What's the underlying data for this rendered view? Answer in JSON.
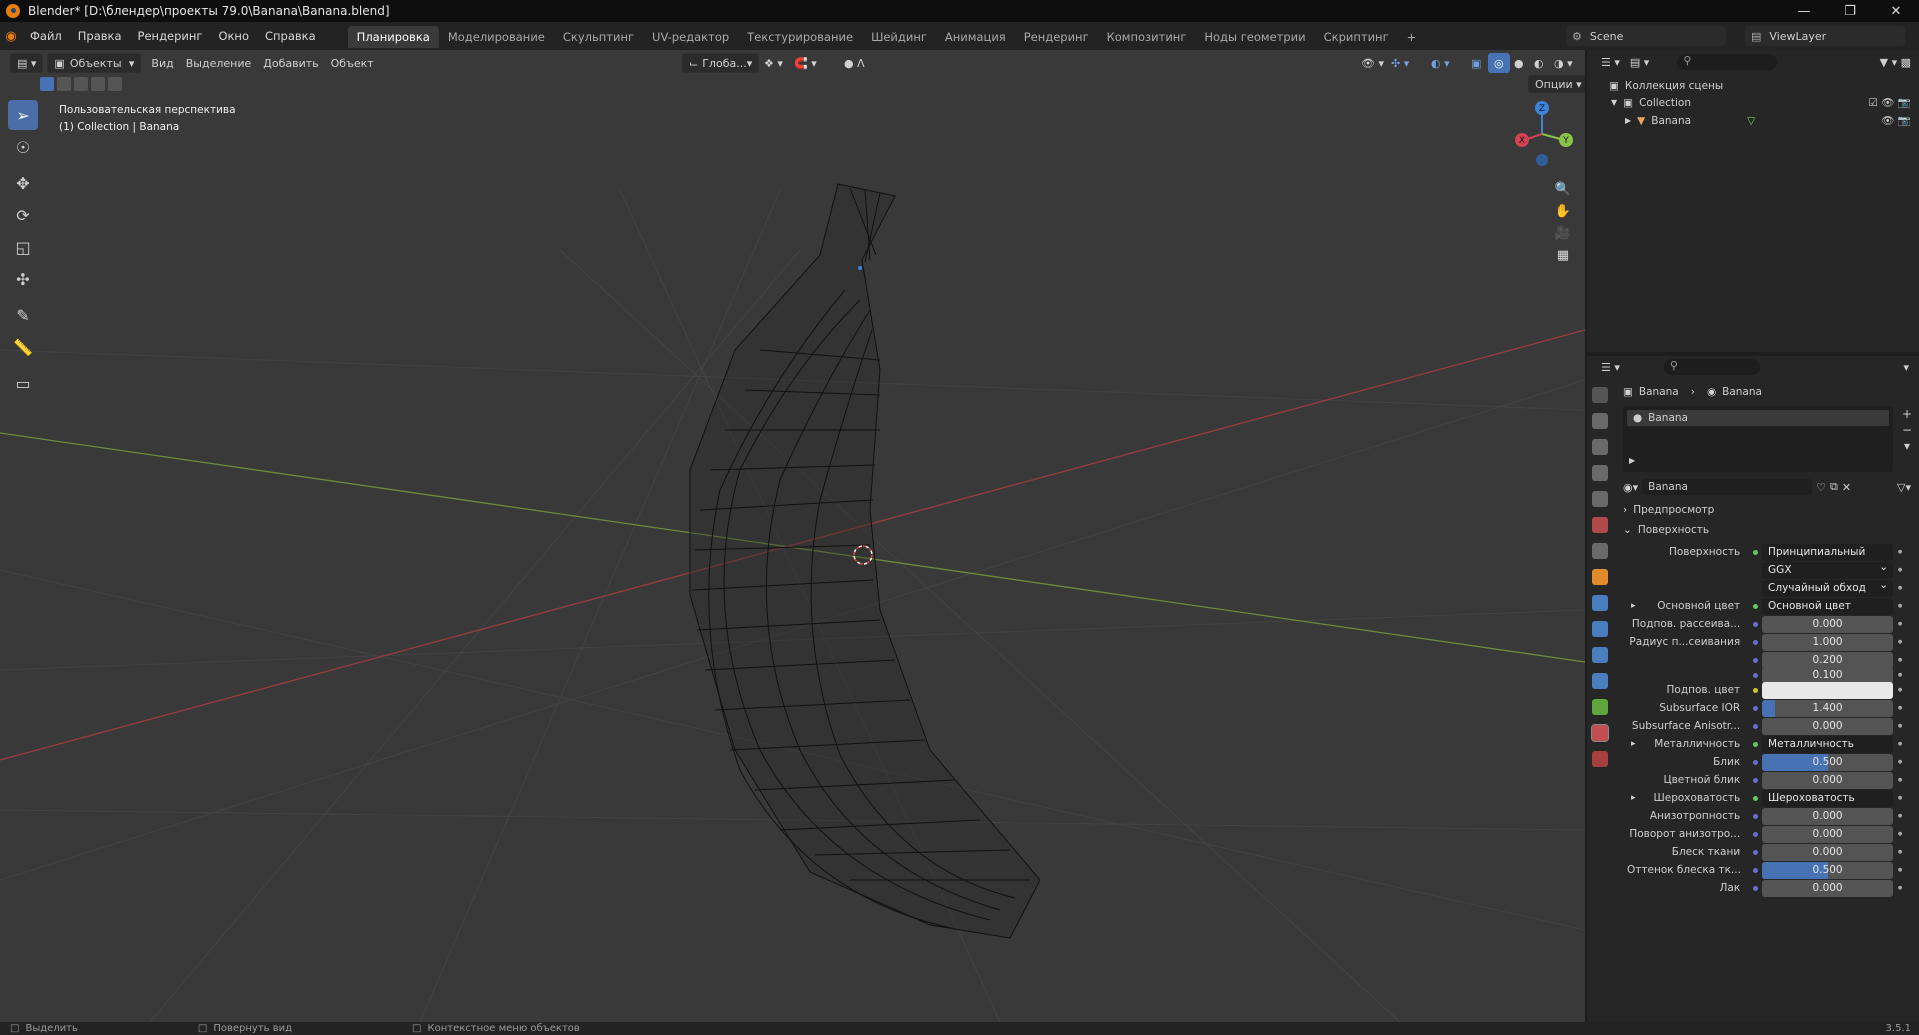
{
  "title": "Blender* [D:\\блендер\\проекты 79.0\\Banana\\Banana.blend]",
  "menu": [
    "Файл",
    "Правка",
    "Рендеринг",
    "Окно",
    "Справка"
  ],
  "workspaces": [
    "Планировка",
    "Моделирование",
    "Скульптинг",
    "UV-редактор",
    "Текстурирование",
    "Шейдинг",
    "Анимация",
    "Рендеринг",
    "Композитинг",
    "Ноды геометрии",
    "Скриптинг"
  ],
  "workspace_add": "+",
  "scene": "Scene",
  "view_layer": "ViewLayer",
  "viewport": {
    "mode": "Объекты",
    "menus": [
      "Вид",
      "Выделение",
      "Добавить",
      "Объект"
    ],
    "orientation": "Глоба...",
    "options": "Опции",
    "overlay_line1": "Пользовательская перспектива",
    "overlay_line2": "(1) Collection | Banana",
    "gizmo": {
      "x": "X",
      "y": "Y",
      "z": "Z"
    }
  },
  "outliner": {
    "scene_collection": "Коллекция сцены",
    "collection": "Collection",
    "object": "Banana"
  },
  "properties": {
    "breadcrumb_obj": "Banana",
    "breadcrumb_mat": "Banana",
    "slot": "Banana",
    "material_name": "Banana",
    "preview": "Предпросмотр",
    "surface": "Поверхность",
    "rows": [
      {
        "label": "Поверхность",
        "value": "Принципиальный BSDF",
        "type": "node"
      },
      {
        "label": "",
        "value": "GGX",
        "type": "select"
      },
      {
        "label": "",
        "value": "Случайный обход",
        "type": "select"
      },
      {
        "label": "Основной цвет",
        "value": "Основной цвет",
        "type": "node",
        "arrow": true
      },
      {
        "label": "Подпов. рассеива...",
        "value": "0.000",
        "type": "num",
        "fill": 0
      },
      {
        "label": "Радиус п...сеивания",
        "value": "1.000",
        "type": "num",
        "fill": 0
      },
      {
        "label": "",
        "value": "0.200",
        "type": "num",
        "fill": 0
      },
      {
        "label": "",
        "value": "0.100",
        "type": "num",
        "fill": 0
      },
      {
        "label": "Подпов. цвет",
        "value": "",
        "type": "color"
      },
      {
        "label": "Subsurface IOR",
        "value": "1.400",
        "type": "num",
        "fill": 0.1
      },
      {
        "label": "Subsurface Anisotr...",
        "value": "0.000",
        "type": "num",
        "fill": 0
      },
      {
        "label": "Металличность",
        "value": "Металличность",
        "type": "node",
        "arrow": true
      },
      {
        "label": "Блик",
        "value": "0.500",
        "type": "num",
        "fill": 0.5
      },
      {
        "label": "Цветной блик",
        "value": "0.000",
        "type": "num",
        "fill": 0
      },
      {
        "label": "Шероховатость",
        "value": "Шероховатость",
        "type": "node",
        "arrow": true
      },
      {
        "label": "Анизотропность",
        "value": "0.000",
        "type": "num",
        "fill": 0
      },
      {
        "label": "Поворот анизотро...",
        "value": "0.000",
        "type": "num",
        "fill": 0
      },
      {
        "label": "Блеск ткани",
        "value": "0.000",
        "type": "num",
        "fill": 0
      },
      {
        "label": "Оттенок блеска тк...",
        "value": "0.500",
        "type": "num",
        "fill": 0.5
      },
      {
        "label": "Лак",
        "value": "0.000",
        "type": "num",
        "fill": 0
      }
    ]
  },
  "status": {
    "select": "Выделить",
    "rotate": "Повернуть вид",
    "context": "Контекстное меню объектов",
    "version": "3.5.1"
  },
  "colors": {
    "accent": "#4772b3",
    "active_tool": "#4b6ea9",
    "x_axis": "#d3424f",
    "y_axis": "#8bc34a",
    "z_axis": "#3b84d8"
  }
}
